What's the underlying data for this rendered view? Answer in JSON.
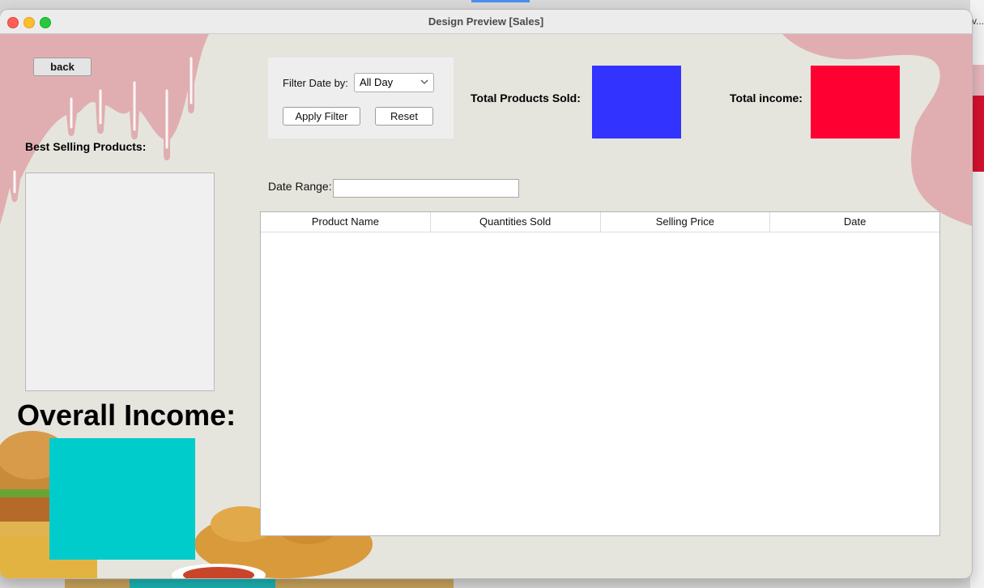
{
  "window": {
    "title": "Design Preview [Sales]"
  },
  "background": {
    "right_peek_text": "v..."
  },
  "nav": {
    "back_label": "back"
  },
  "best_selling": {
    "label": "Best Selling Products:"
  },
  "filter": {
    "label": "Filter Date by:",
    "selected": "All Day",
    "apply_label": "Apply Filter",
    "reset_label": "Reset"
  },
  "stats": {
    "products_sold_label": "Total Products Sold:",
    "income_label": "Total income:",
    "products_sold_color": "#3333ff",
    "income_color": "#ff0033"
  },
  "date_range": {
    "label": "Date Range:",
    "value": ""
  },
  "table": {
    "columns": [
      "Product Name",
      "Quantities Sold",
      "Selling Price",
      "Date"
    ],
    "rows": []
  },
  "overall": {
    "label": "Overall Income:",
    "color": "#00cccc"
  },
  "colors": {
    "drip": "#e0aeb1",
    "window_bg": "#e5e5dd"
  }
}
